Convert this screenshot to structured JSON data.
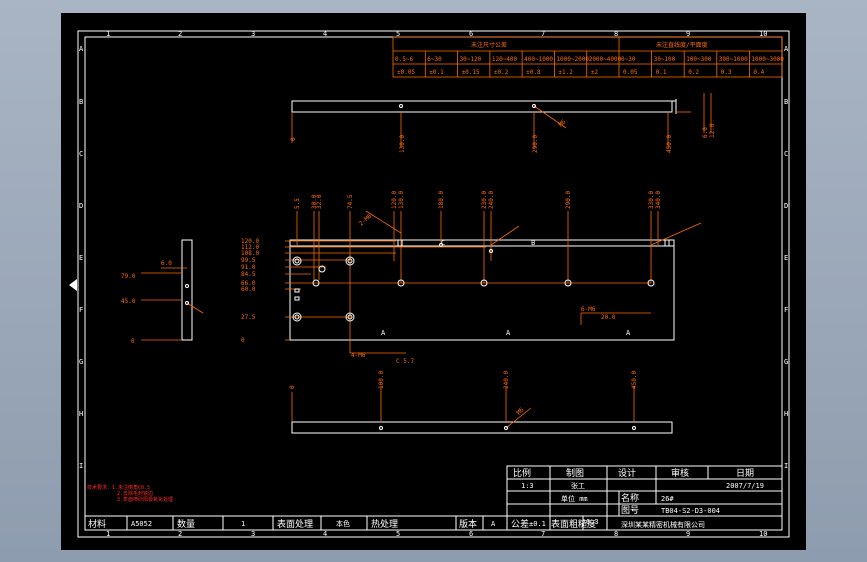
{
  "borders": {
    "col_labels": [
      "1",
      "2",
      "3",
      "4",
      "5",
      "6",
      "7",
      "8",
      "9",
      "10"
    ],
    "row_labels": [
      "A",
      "B",
      "C",
      "D",
      "E",
      "F",
      "G",
      "H",
      "I"
    ]
  },
  "tolerance_table": {
    "header_left": "未注尺寸公差",
    "header_right": "未注直线度/平面度",
    "ranges": [
      "0.5~6",
      "6~30",
      "30~120",
      "120~400",
      "400~1000",
      "1000~2000",
      "2000~4000",
      "0~30",
      "30~100",
      "100~300",
      "300~1000",
      "1000~3000"
    ],
    "values": [
      "±0.05",
      "±0.1",
      "±0.15",
      "±0.2",
      "±0.8",
      "±1.2",
      "±2",
      "0.05",
      "0.1",
      "0.2",
      "0.3",
      "0.4"
    ]
  },
  "top_view": {
    "dims": [
      "0",
      "130.0",
      "290.0",
      "450.0",
      "6.0",
      "12.0"
    ],
    "callout": "M6"
  },
  "side_view": {
    "dims": [
      "6.0",
      "79.0",
      "45.0",
      "0"
    ]
  },
  "front_view": {
    "top_dims": [
      "5.5",
      "30.0",
      "32.0",
      "74.5",
      "120.0",
      "130.0",
      "180.0",
      "230.0",
      "240.0",
      "290.0",
      "330.0",
      "340.0"
    ],
    "left_dims": [
      "120.0",
      "112.0",
      "108.0",
      "99.5",
      "91.0",
      "84.5",
      "66.0",
      "60.0",
      "27.5",
      "0"
    ],
    "notes": [
      "4-M6",
      "6-M6",
      "2-M6",
      "C 5.7",
      "20.0"
    ],
    "letter_marks": [
      "A",
      "A",
      "A",
      "B",
      "C"
    ]
  },
  "bottom_view": {
    "dims": [
      "0",
      "100.0",
      "240.0",
      "450.0"
    ],
    "callout": "M6"
  },
  "tech_note": {
    "lines": [
      "技术要求：1.未注倒角C0.5",
      "2.去除毛刺锐边",
      "3.表面喷砂阳极氧化处理"
    ]
  },
  "title_block": {
    "headers": [
      "比例",
      "制图",
      "设计",
      "审核",
      "日期"
    ],
    "scale": "1:3",
    "date": "2007/7/19",
    "drawn_by": "张工",
    "qty_label": "名称",
    "code_label": "图号",
    "qty_code": "26#",
    "drawing_no": "TB04-S2-D3-004",
    "material_label": "材料",
    "material": "A5052",
    "count_label": "数量",
    "count": "1",
    "surface_label": "表面处理",
    "surface": "本色",
    "heat_label": "热处理",
    "version_label": "版本",
    "version": "A",
    "tolerance_label": "公差",
    "tolerance": "±0.1",
    "roughness_label": "表面粗糙度",
    "roughness": "6.3",
    "company": "深圳某某精密机械有限公司",
    "unit_note": "单位 mm"
  }
}
